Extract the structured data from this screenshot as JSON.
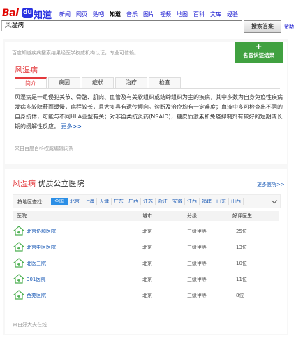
{
  "logo": {
    "bai": "Bai",
    "du": "du",
    "zhidao": "知道"
  },
  "nav": [
    "新闻",
    "网页",
    "贴吧",
    "知道",
    "音乐",
    "图片",
    "视频",
    "地图",
    "百科",
    "文库",
    "经验"
  ],
  "nav_active": "知道",
  "search": {
    "value": "风湿病",
    "button": "搜索答案",
    "help": "帮助"
  },
  "card": {
    "disclaimer": "百度知道疾病搜索结果经医学权威机构认证，专业可信赖。",
    "badge": {
      "plus": "+",
      "label": "名医认证结果"
    },
    "title": "风湿病",
    "tabs": [
      "简介",
      "病因",
      "症状",
      "治疗",
      "检查"
    ],
    "active_tab": "简介",
    "description": "风湿病是一组侵犯关节、骨骼、肌肉、血管及有关软组织或结缔组织为主的疾病，其中多数为自身免疫性疾病发病多较隐蔽而缓慢，病程较长，且大多具有遗传倾向。诊断及治疗均有一定难度；血液中多可检查出不同的自身抗体，可能与不同HLA亚型有关；对非甾类抗炎药(NSAID)，糖皮质激素和免疫抑制剂有较好的短期或长期的缓解性反应。",
    "more": "更多>>",
    "source": "来自百度百科权威编辑词条"
  },
  "hospitals": {
    "title_red": "风湿病",
    "title_rest": "优质公立医院",
    "more": "更多医院>>",
    "filter_label": "按地区查找:",
    "regions": [
      "全国",
      "北京",
      "上海",
      "天津",
      "广东",
      "广西",
      "江苏",
      "浙江",
      "安徽",
      "江西",
      "福建",
      "山东",
      "山西"
    ],
    "selected_region": "全国",
    "columns": [
      "医院",
      "城市",
      "分级",
      "好评医生"
    ],
    "rows": [
      {
        "name": "北京协和医院",
        "city": "北京",
        "level": "三级甲等",
        "doctors": "25位"
      },
      {
        "name": "北京中医医院",
        "city": "北京",
        "level": "三级甲等",
        "doctors": "13位"
      },
      {
        "name": "北医三院",
        "city": "北京",
        "level": "三级甲等",
        "doctors": "10位"
      },
      {
        "name": "301医院",
        "city": "北京",
        "level": "三级甲等",
        "doctors": "11位"
      },
      {
        "name": "西苑医院",
        "city": "北京",
        "level": "三级甲等",
        "doctors": "8位"
      }
    ],
    "source": "来自好大夫在线"
  },
  "colors": {
    "brand_red": "#e4393c",
    "badge_green": "#40a140",
    "link_blue": "#1a5ab6",
    "region_active": "#2c8fe6"
  }
}
